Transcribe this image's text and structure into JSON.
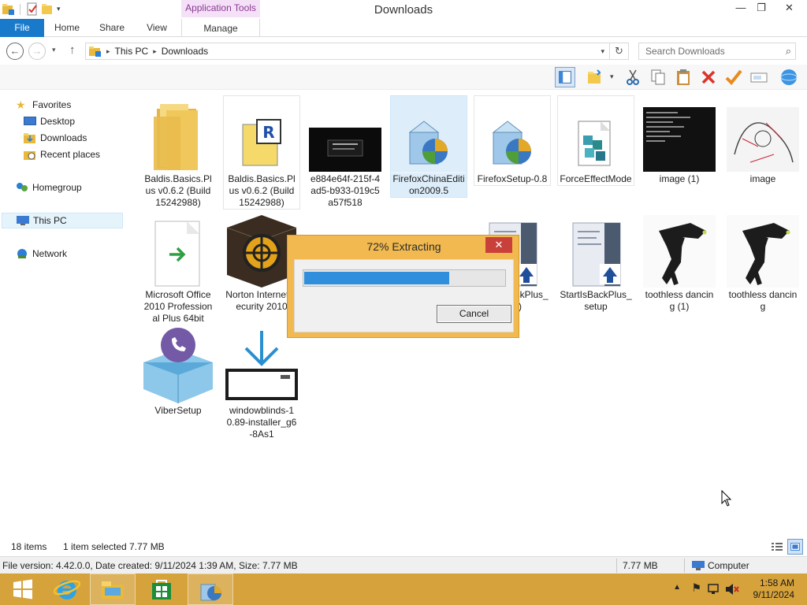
{
  "window": {
    "title": "Downloads",
    "context_tab_group": "Application Tools",
    "minimize_glyph": "—",
    "maximize_glyph": "❐",
    "close_glyph": "✕"
  },
  "ribbon": {
    "tabs": [
      "File",
      "Home",
      "Share",
      "View",
      "Manage"
    ]
  },
  "address": {
    "crumbs": [
      "This PC",
      "Downloads"
    ],
    "search_placeholder": "Search Downloads"
  },
  "nav": {
    "favorites": "Favorites",
    "desktop": "Desktop",
    "downloads": "Downloads",
    "recent": "Recent places",
    "homegroup": "Homegroup",
    "this_pc": "This PC",
    "network": "Network"
  },
  "files": [
    {
      "label": "Baldis.Basics.Plus v0.6.2 (Build 15242988)",
      "icon": "folder-icon"
    },
    {
      "label": "Baldis.Basics.Plus v0.6.2 (Build 15242988)",
      "icon": "rar-archive-icon"
    },
    {
      "label": "e884e64f-215f-4ad5-b933-019c5a57f518",
      "icon": "screenshot-thumbnail"
    },
    {
      "label": "FirefoxChinaEdition2009.5",
      "icon": "installer-icon"
    },
    {
      "label": "FirefoxSetup-0.8",
      "icon": "installer-icon"
    },
    {
      "label": "ForceEffectMode",
      "icon": "registry-file-icon"
    },
    {
      "label": "image (1)",
      "icon": "terminal-thumbnail"
    },
    {
      "label": "image",
      "icon": "sketch-thumbnail"
    },
    {
      "label": "Microsoft Office 2010 Professional Plus 64bit",
      "icon": "shortcut-file-icon"
    },
    {
      "label": "Norton Internet Security 2010",
      "icon": "norton-box-icon"
    },
    {
      "label": "StartIsBackPlus_s (1)",
      "icon": "setup-icon"
    },
    {
      "label": "StartIsBackPlus_setup",
      "icon": "setup-icon"
    },
    {
      "label": "toothless dancing (1)",
      "icon": "dragon-thumbnail"
    },
    {
      "label": "toothless dancing",
      "icon": "dragon-thumbnail"
    },
    {
      "label": "ViberSetup",
      "icon": "viber-box-icon"
    },
    {
      "label": "windowblinds-10.89-installer_g6-8As1",
      "icon": "download-installer-icon"
    }
  ],
  "dialog": {
    "title": "72% Extracting",
    "progress": 0.72,
    "cancel_label": "Cancel",
    "close_glyph": "✕"
  },
  "status": {
    "item_count": "18 items",
    "selection": "1 item selected",
    "selection_size": "7.77 MB"
  },
  "infobar": {
    "details": "File version: 4.42.0.0, Date created: 9/11/2024 1:39 AM, Size: 7.77 MB",
    "size": "7.77 MB",
    "location": "Computer"
  },
  "taskbar": {
    "time": "1:58 AM",
    "date": "9/11/2024"
  },
  "colors": {
    "accent": "#1979ca",
    "taskbar": "#d6a23b",
    "dialog_frame": "#f1b94f",
    "progress": "#2f8fdc"
  }
}
